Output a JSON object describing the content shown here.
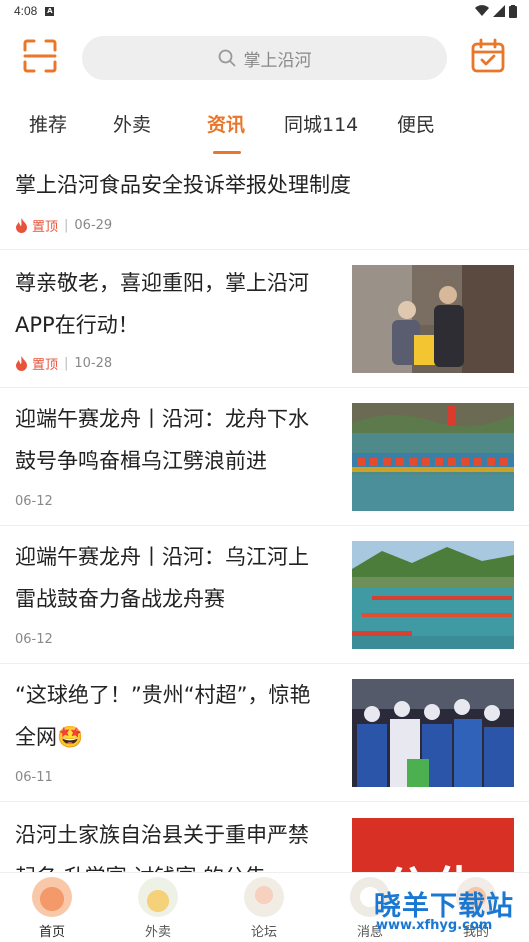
{
  "status": {
    "time": "4:08",
    "notif": "A"
  },
  "search": {
    "placeholder": "掌上沿河"
  },
  "tabs": [
    {
      "label": "推荐"
    },
    {
      "label": "外卖"
    },
    {
      "label": "资讯"
    },
    {
      "label": "同城114"
    },
    {
      "label": "便民"
    }
  ],
  "news": [
    {
      "title1": "掌上沿河食品安全投诉举报处理制度",
      "pin": "置顶",
      "date": "06-29"
    },
    {
      "title1": "尊亲敬老，喜迎重阳，掌上沿河",
      "title2": "APP在行动！",
      "pin": "置顶",
      "date": "10-28"
    },
    {
      "title1": "迎端午赛龙舟丨沿河：龙舟下水",
      "title2": "鼓号争鸣奋楫乌江劈浪前进",
      "date": "06-12"
    },
    {
      "title1": "迎端午赛龙舟丨沿河：乌江河上",
      "title2": "雷战鼓奋力备战龙舟赛",
      "date": "06-12"
    },
    {
      "title1": "“这球绝了！”贵州“村超”，惊艳",
      "title2": "全网🤩",
      "date": "06-11"
    },
    {
      "title1": "沿河土家族自治县关于重申严禁",
      "title2": "起名  升学宴  讨钱宴  的公告",
      "thumb_text": "公告"
    }
  ],
  "bottom_nav": [
    {
      "label": "首页"
    },
    {
      "label": "外卖"
    },
    {
      "label": "论坛"
    },
    {
      "label": "消息"
    },
    {
      "label": "我的"
    }
  ],
  "watermark": {
    "line1": "晓羊下载站",
    "line2": "www.xfhyg.com"
  },
  "colors": {
    "accent": "#e8772b",
    "pin": "#e8543b"
  }
}
